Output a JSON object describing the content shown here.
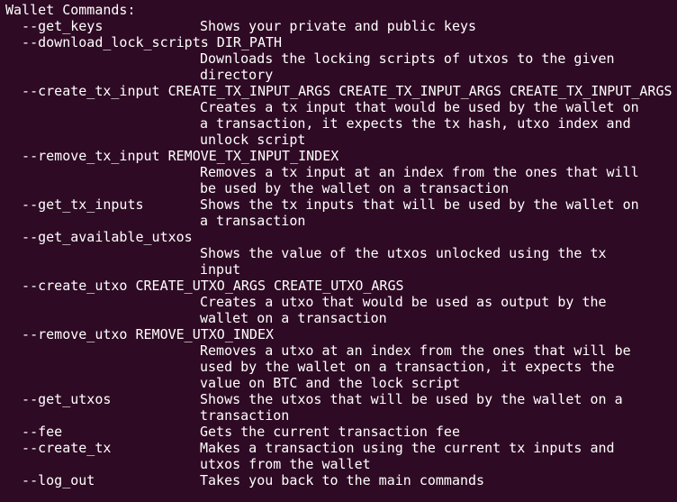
{
  "terminal": {
    "background": "#2f0a24",
    "foreground": "#ffffff",
    "lines": [
      {
        "text": "Wallet Commands:"
      },
      {
        "text": "  --get_keys",
        "desc": "Shows your private and public keys"
      },
      {
        "text": "  --download_lock_scripts DIR_PATH"
      },
      {
        "desc": "Downloads the locking scripts of utxos to the given"
      },
      {
        "desc": "directory"
      },
      {
        "text": "  --create_tx_input CREATE_TX_INPUT_ARGS CREATE_TX_INPUT_ARGS CREATE_TX_INPUT_ARGS"
      },
      {
        "desc": "Creates a tx input that would be used by the wallet on"
      },
      {
        "desc": "a transaction, it expects the tx hash, utxo index and"
      },
      {
        "desc": "unlock script"
      },
      {
        "text": "  --remove_tx_input REMOVE_TX_INPUT_INDEX"
      },
      {
        "desc": "Removes a tx input at an index from the ones that will"
      },
      {
        "desc": "be used by the wallet on a transaction"
      },
      {
        "text": "  --get_tx_inputs",
        "desc": "Shows the tx inputs that will be used by the wallet on"
      },
      {
        "desc": "a transaction"
      },
      {
        "text": "  --get_available_utxos"
      },
      {
        "desc": "Shows the value of the utxos unlocked using the tx"
      },
      {
        "desc": "input"
      },
      {
        "text": "  --create_utxo CREATE_UTXO_ARGS CREATE_UTXO_ARGS"
      },
      {
        "desc": "Creates a utxo that would be used as output by the"
      },
      {
        "desc": "wallet on a transaction"
      },
      {
        "text": "  --remove_utxo REMOVE_UTXO_INDEX"
      },
      {
        "desc": "Removes a utxo at an index from the ones that will be"
      },
      {
        "desc": "used by the wallet on a transaction, it expects the"
      },
      {
        "desc": "value on BTC and the lock script"
      },
      {
        "text": "  --get_utxos",
        "desc": "Shows the utxos that will be used by the wallet on a"
      },
      {
        "desc": "transaction"
      },
      {
        "text": "  --fee",
        "desc": "Gets the current transaction fee"
      },
      {
        "text": "  --create_tx",
        "desc": "Makes a transaction using the current tx inputs and"
      },
      {
        "desc": "utxos from the wallet"
      },
      {
        "text": "  --log_out",
        "desc": "Takes you back to the main commands"
      }
    ]
  }
}
